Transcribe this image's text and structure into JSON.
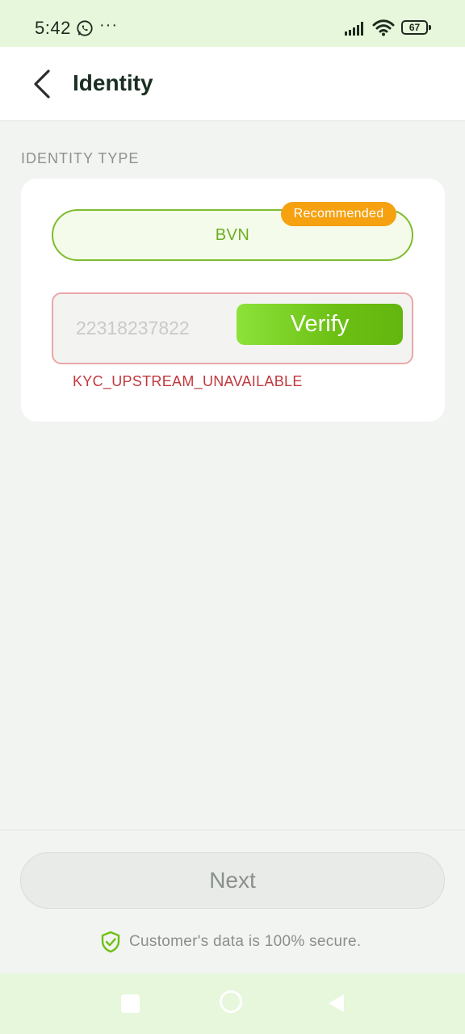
{
  "status_bar": {
    "time": "5:42",
    "more": "···",
    "battery": "67"
  },
  "header": {
    "title": "Identity"
  },
  "section": {
    "label": "IDENTITY TYPE"
  },
  "identity_option": {
    "label": "BVN",
    "badge": "Recommended"
  },
  "bvn_input": {
    "placeholder": "22318237822"
  },
  "verify_button": {
    "label": "Verify"
  },
  "error": {
    "message": "KYC_UPSTREAM_UNAVAILABLE"
  },
  "footer": {
    "next_label": "Next",
    "secure_text": "Customer's data is 100% secure."
  },
  "colors": {
    "accent_green": "#6cc014",
    "badge_orange": "#f5a110",
    "error_red": "#c1383d",
    "status_bar_bg": "#e6f7db"
  }
}
